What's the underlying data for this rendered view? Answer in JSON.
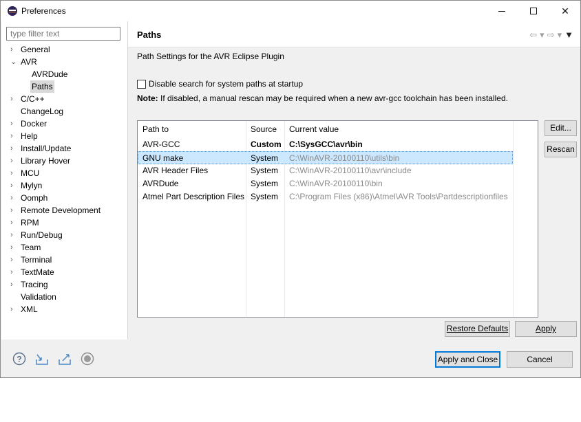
{
  "window": {
    "title": "Preferences"
  },
  "filter": {
    "placeholder": "type filter text"
  },
  "tree": [
    {
      "label": "General",
      "expander": "collapsed"
    },
    {
      "label": "AVR",
      "expander": "expanded"
    },
    {
      "label": "AVRDude",
      "child": true
    },
    {
      "label": "Paths",
      "child": true,
      "selected": true
    },
    {
      "label": "C/C++",
      "expander": "collapsed"
    },
    {
      "label": "ChangeLog"
    },
    {
      "label": "Docker",
      "expander": "collapsed"
    },
    {
      "label": "Help",
      "expander": "collapsed"
    },
    {
      "label": "Install/Update",
      "expander": "collapsed"
    },
    {
      "label": "Library Hover",
      "expander": "collapsed"
    },
    {
      "label": "MCU",
      "expander": "collapsed"
    },
    {
      "label": "Mylyn",
      "expander": "collapsed"
    },
    {
      "label": "Oomph",
      "expander": "collapsed"
    },
    {
      "label": "Remote Development",
      "expander": "collapsed"
    },
    {
      "label": "RPM",
      "expander": "collapsed"
    },
    {
      "label": "Run/Debug",
      "expander": "collapsed"
    },
    {
      "label": "Team",
      "expander": "collapsed"
    },
    {
      "label": "Terminal",
      "expander": "collapsed"
    },
    {
      "label": "TextMate",
      "expander": "collapsed"
    },
    {
      "label": "Tracing",
      "expander": "collapsed"
    },
    {
      "label": "Validation"
    },
    {
      "label": "XML",
      "expander": "collapsed"
    }
  ],
  "page": {
    "title": "Paths",
    "description": "Path Settings for the AVR Eclipse Plugin",
    "checkbox_label": "Disable search for system paths at startup",
    "checkbox_checked": false,
    "note_prefix": "Note:",
    "note_text": " If disabled, a manual rescan may be required when a new avr-gcc toolchain has been installed."
  },
  "table": {
    "headers": [
      "Path to",
      "Source",
      "Current value"
    ],
    "rows": [
      {
        "path": "AVR-GCC",
        "source": "Custom",
        "value": "C:\\SysGCC\\avr\\bin",
        "custom": true
      },
      {
        "path": "GNU make",
        "source": "System",
        "value": "C:\\WinAVR-20100110\\utils\\bin",
        "selected": true
      },
      {
        "path": "AVR Header Files",
        "source": "System",
        "value": "C:\\WinAVR-20100110\\avr\\include"
      },
      {
        "path": "AVRDude",
        "source": "System",
        "value": "C:\\WinAVR-20100110\\bin"
      },
      {
        "path": "Atmel Part Description Files",
        "source": "System",
        "value": "C:\\Program Files (x86)\\Atmel\\AVR Tools\\Partdescriptionfiles"
      }
    ]
  },
  "buttons": {
    "edit": "Edit...",
    "rescan": "Rescan",
    "restore_defaults": "Restore Defaults",
    "apply": "Apply",
    "apply_and_close": "Apply and Close",
    "cancel": "Cancel"
  },
  "icons": [
    "help-icon",
    "import-icon",
    "export-icon",
    "record-icon"
  ]
}
